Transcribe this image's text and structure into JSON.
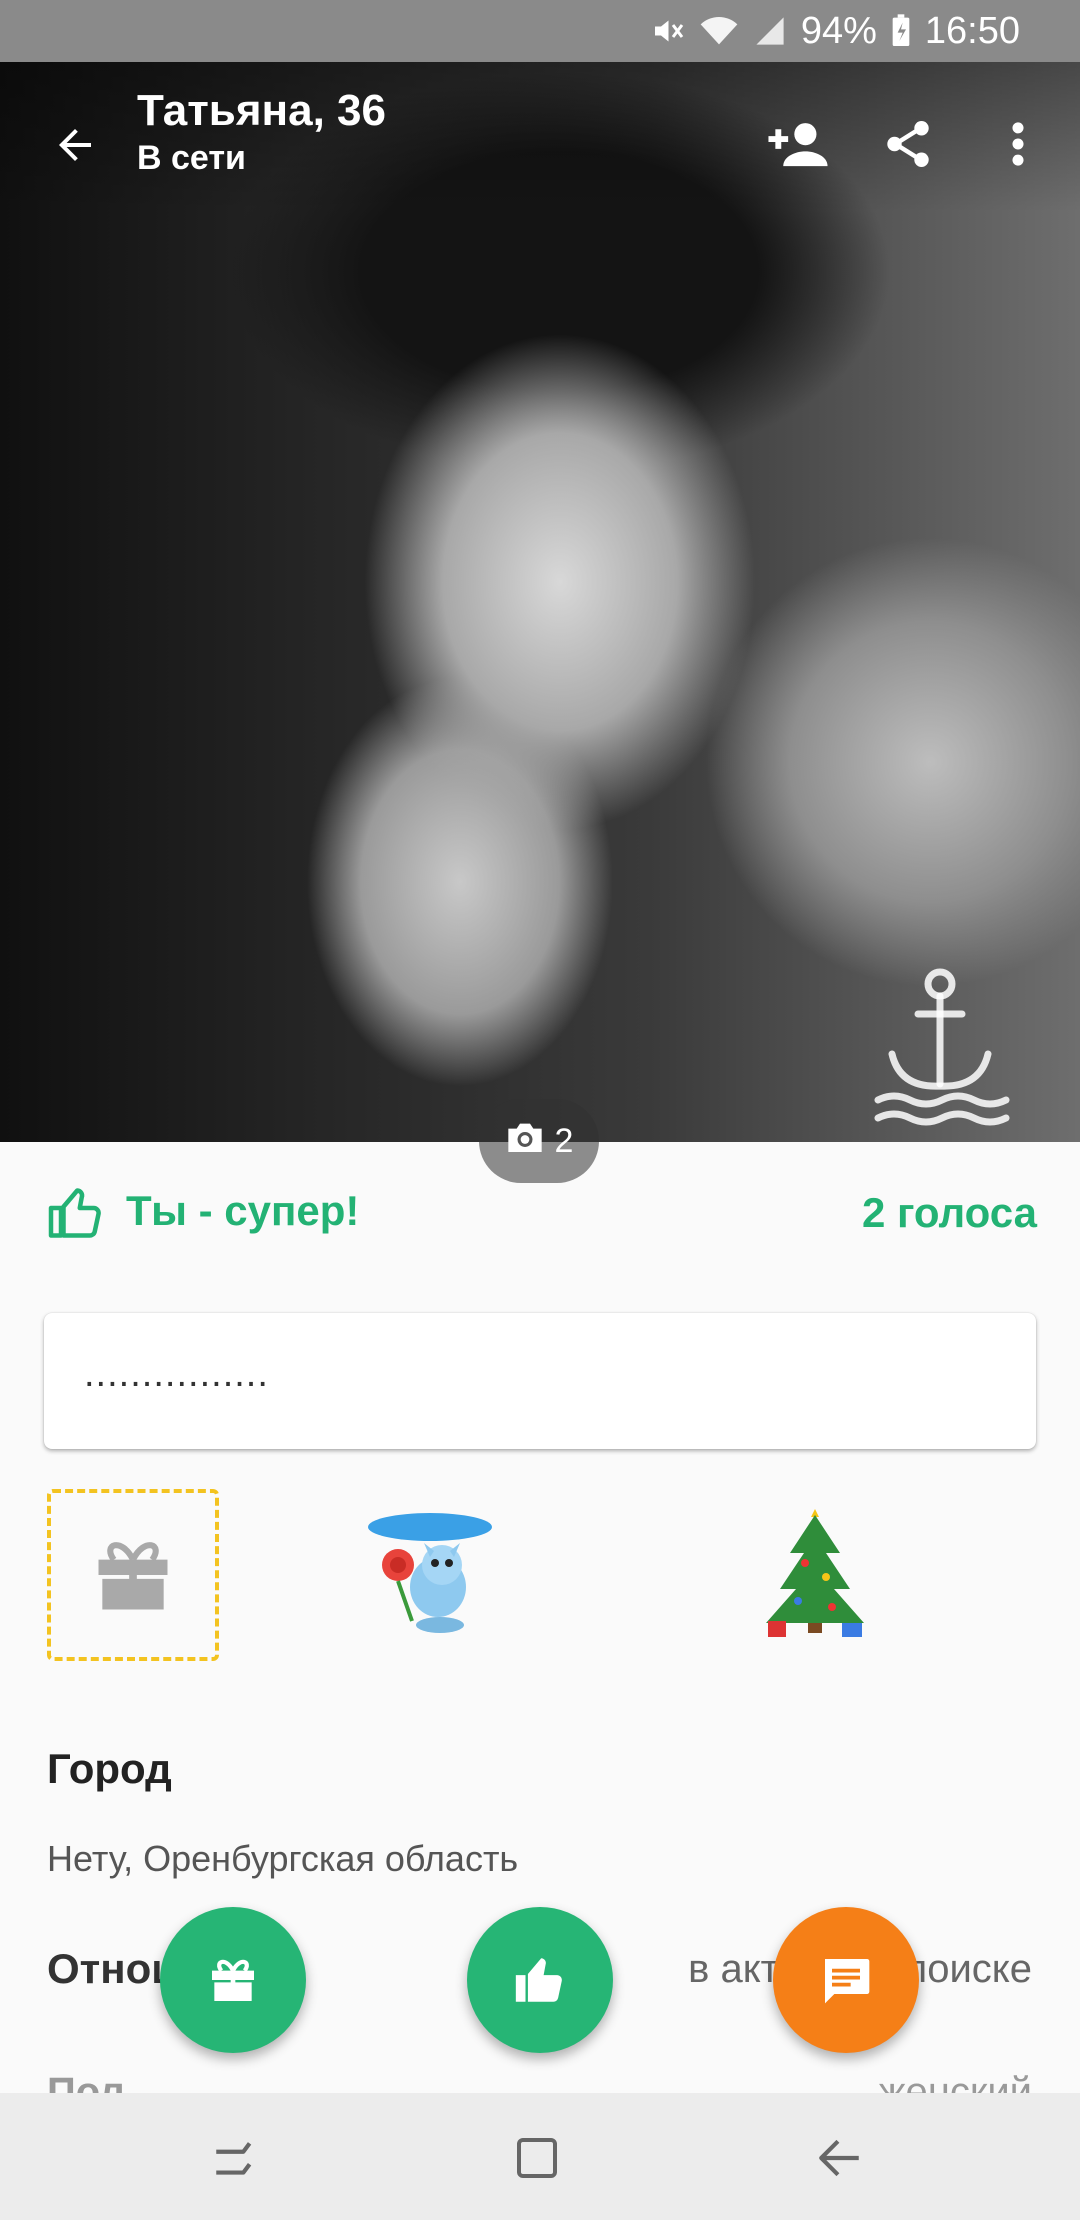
{
  "status_bar": {
    "battery": "94%",
    "time": "16:50"
  },
  "profile": {
    "name_age": "Татьяна, 36",
    "presence": "В сети",
    "photo_count": "2"
  },
  "rating": {
    "label": "Ты - супер!",
    "votes": "2 голоса"
  },
  "status_message": "................",
  "info": {
    "city_title": "Город",
    "city_value": "Нету, Оренбургская область",
    "relationship_label": "Отношения",
    "relationship_value": "в активном поиске",
    "gender_label": "Пол",
    "gender_value": "женский"
  },
  "icons": {
    "back": "arrow-left",
    "add_friend": "person-add",
    "share": "share",
    "more": "more-vertical",
    "camera": "camera",
    "thumb": "thumbs-up",
    "gift": "gift",
    "chat": "message"
  },
  "colors": {
    "accent_green": "#23b274",
    "fab_orange": "#f57f17",
    "gift_slot_border": "#f3c320"
  }
}
